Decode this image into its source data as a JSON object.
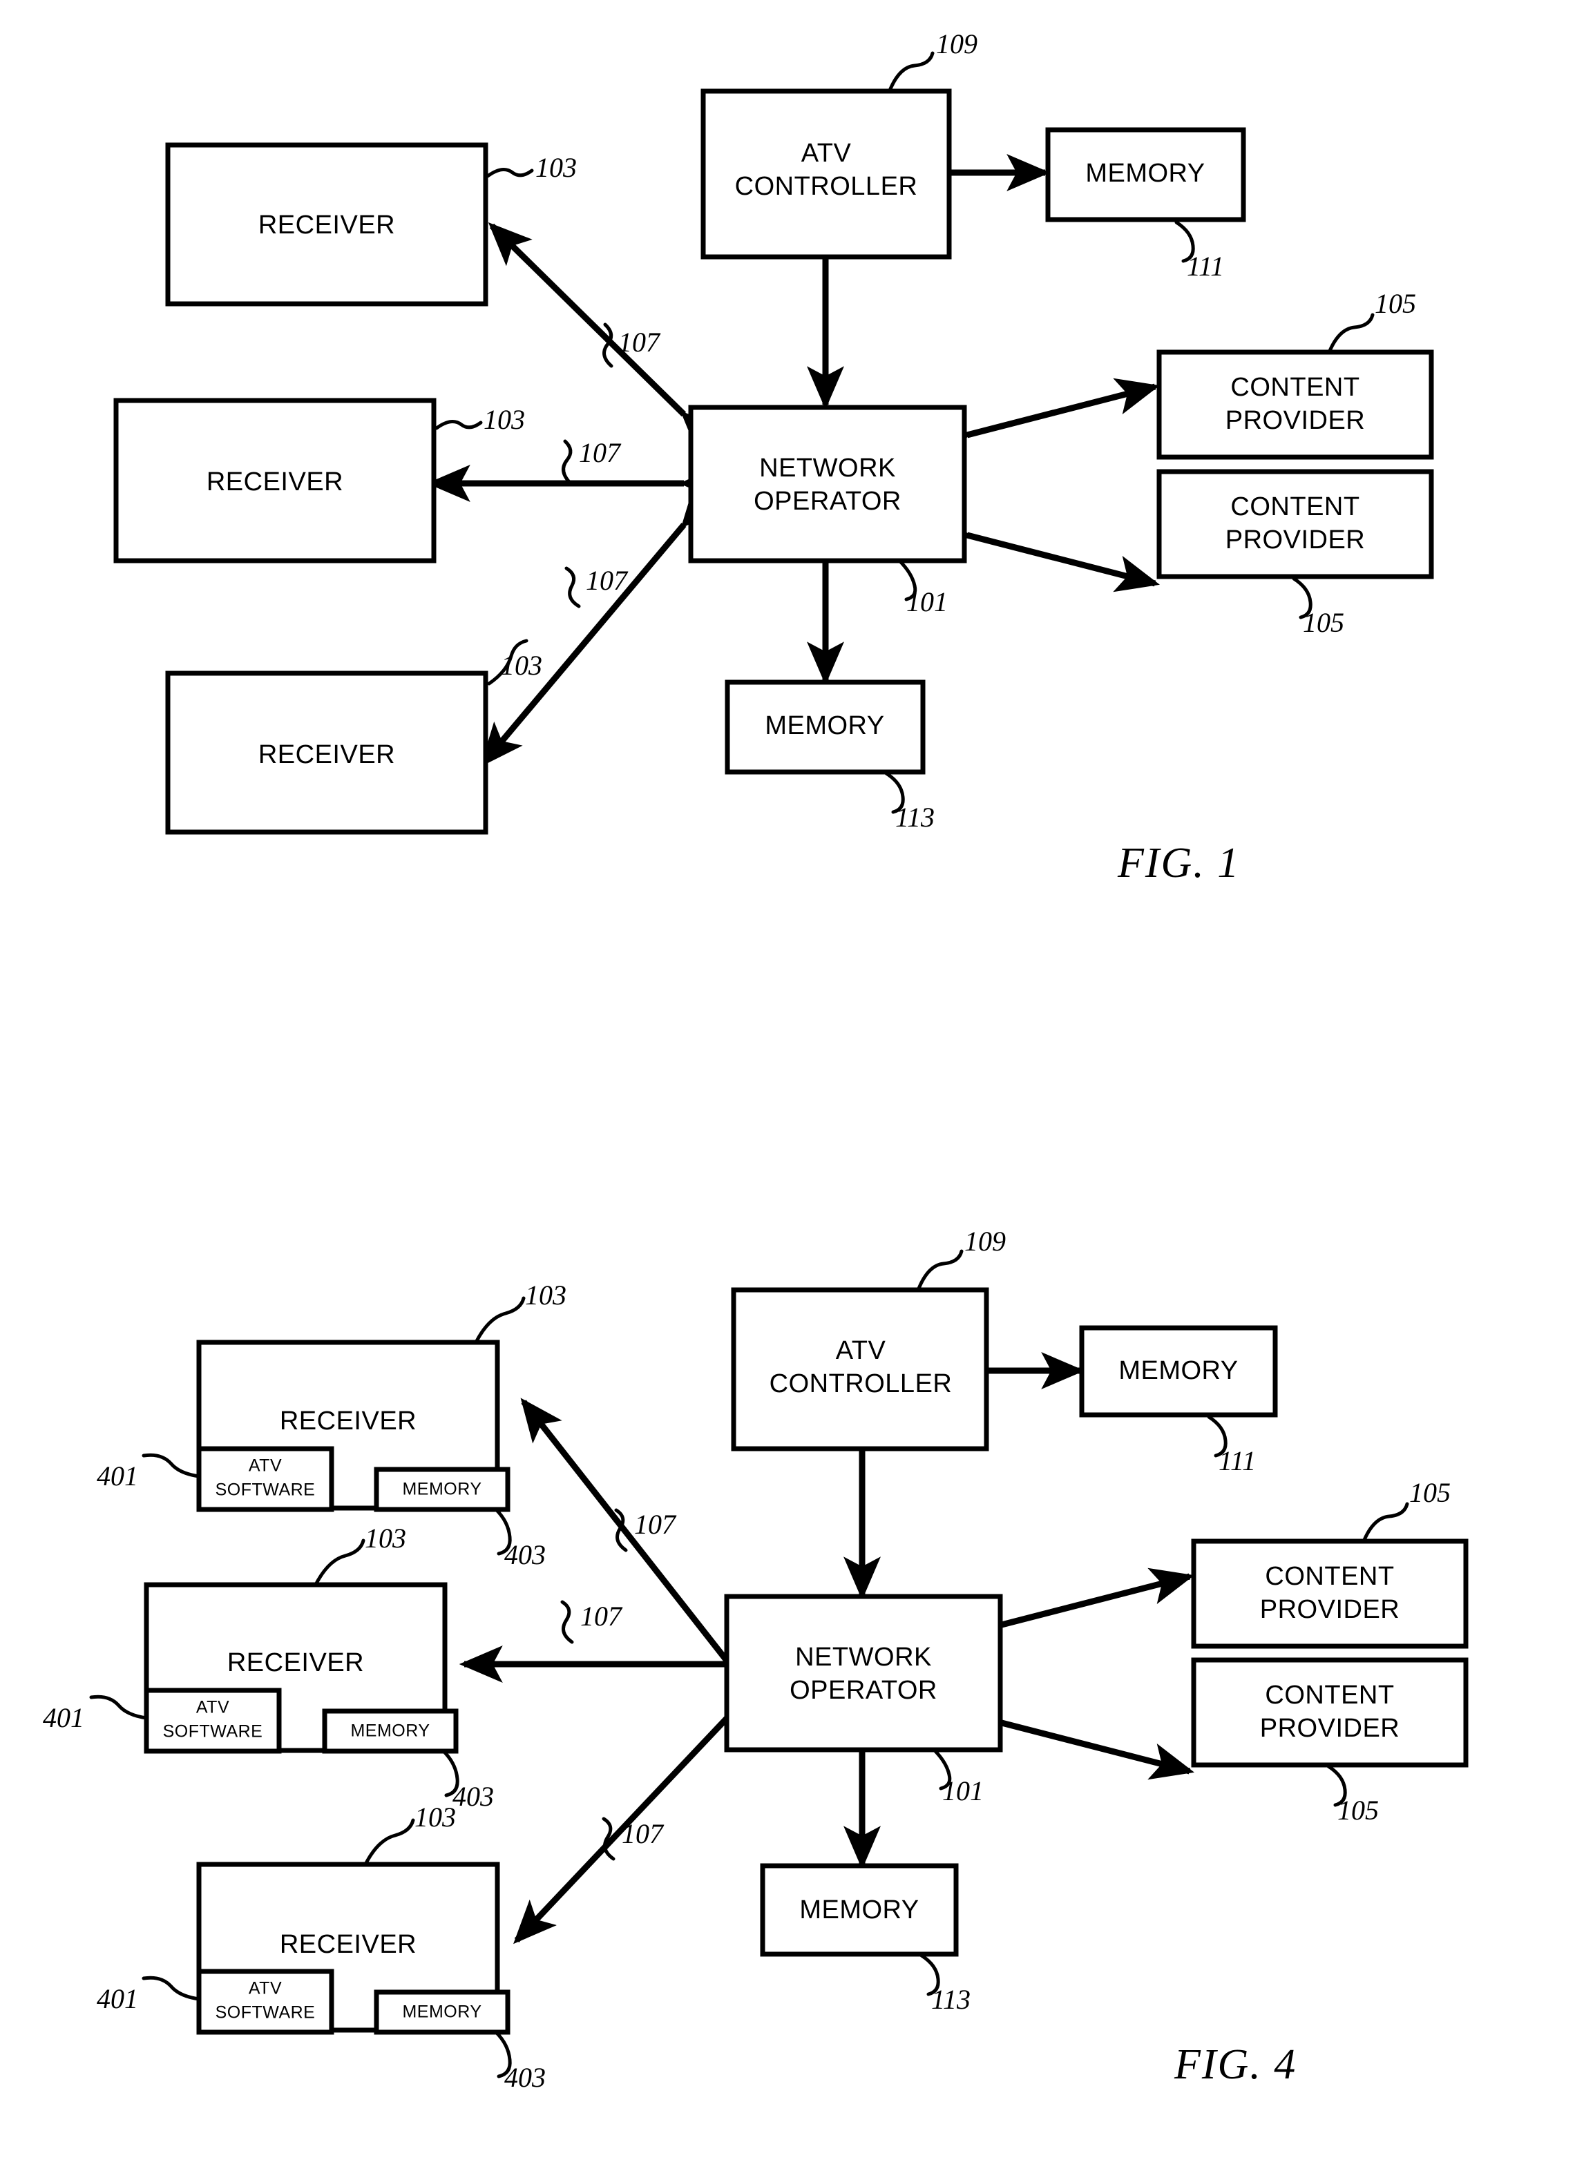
{
  "document": {
    "type": "patent-drawing-sheet",
    "figures": [
      {
        "id": "fig1",
        "caption": "FIG. 1",
        "nodes": [
          {
            "id": "receiver-1",
            "label": "RECEIVER",
            "ref": "103"
          },
          {
            "id": "receiver-2",
            "label": "RECEIVER",
            "ref": "103"
          },
          {
            "id": "receiver-3",
            "label": "RECEIVER",
            "ref": "103"
          },
          {
            "id": "atv-controller",
            "label_line1": "ATV",
            "label_line2": "CONTROLLER",
            "ref": "109"
          },
          {
            "id": "atv-memory",
            "label": "MEMORY",
            "ref": "111"
          },
          {
            "id": "network-operator",
            "label_line1": "NETWORK",
            "label_line2": "OPERATOR",
            "ref": "101"
          },
          {
            "id": "network-memory",
            "label": "MEMORY",
            "ref": "113"
          },
          {
            "id": "content-provider-1",
            "label_line1": "CONTENT",
            "label_line2": "PROVIDER",
            "ref": "105"
          },
          {
            "id": "content-provider-2",
            "label_line1": "CONTENT",
            "label_line2": "PROVIDER",
            "ref": "105"
          }
        ],
        "links": [
          {
            "from": "receiver-1",
            "to": "network-operator",
            "ref": "107",
            "style": "bidirectional"
          },
          {
            "from": "receiver-2",
            "to": "network-operator",
            "ref": "107",
            "style": "bidirectional"
          },
          {
            "from": "receiver-3",
            "to": "network-operator",
            "ref": "107",
            "style": "bidirectional"
          },
          {
            "from": "atv-controller",
            "to": "atv-memory",
            "ref": "",
            "style": "bidirectional"
          },
          {
            "from": "atv-controller",
            "to": "network-operator",
            "ref": "",
            "style": "bidirectional"
          },
          {
            "from": "network-operator",
            "to": "network-memory",
            "ref": "",
            "style": "bidirectional"
          },
          {
            "from": "network-operator",
            "to": "content-provider-1",
            "ref": "",
            "style": "bidirectional"
          },
          {
            "from": "network-operator",
            "to": "content-provider-2",
            "ref": "",
            "style": "bidirectional"
          }
        ]
      },
      {
        "id": "fig4",
        "caption": "FIG. 4",
        "nodes": [
          {
            "id": "receiver-1",
            "label": "RECEIVER",
            "ref": "103",
            "children": [
              {
                "id": "atv-software",
                "label_line1": "ATV",
                "label_line2": "SOFTWARE",
                "ref": "401"
              },
              {
                "id": "rx-memory",
                "label": "MEMORY",
                "ref": "403"
              }
            ]
          },
          {
            "id": "receiver-2",
            "label": "RECEIVER",
            "ref": "103",
            "children": [
              {
                "id": "atv-software",
                "label_line1": "ATV",
                "label_line2": "SOFTWARE",
                "ref": "401"
              },
              {
                "id": "rx-memory",
                "label": "MEMORY",
                "ref": "403"
              }
            ]
          },
          {
            "id": "receiver-3",
            "label": "RECEIVER",
            "ref": "103",
            "children": [
              {
                "id": "atv-software",
                "label_line1": "ATV",
                "label_line2": "SOFTWARE",
                "ref": "401"
              },
              {
                "id": "rx-memory",
                "label": "MEMORY",
                "ref": "403"
              }
            ]
          },
          {
            "id": "atv-controller",
            "label_line1": "ATV",
            "label_line2": "CONTROLLER",
            "ref": "109"
          },
          {
            "id": "atv-memory",
            "label": "MEMORY",
            "ref": "111"
          },
          {
            "id": "network-operator",
            "label_line1": "NETWORK",
            "label_line2": "OPERATOR",
            "ref": "101"
          },
          {
            "id": "network-memory",
            "label": "MEMORY",
            "ref": "113"
          },
          {
            "id": "content-provider-1",
            "label_line1": "CONTENT",
            "label_line2": "PROVIDER",
            "ref": "105"
          },
          {
            "id": "content-provider-2",
            "label_line1": "CONTENT",
            "label_line2": "PROVIDER",
            "ref": "105"
          }
        ],
        "links": [
          {
            "from": "receiver-1",
            "to": "network-operator",
            "ref": "107",
            "style": "bidirectional"
          },
          {
            "from": "receiver-2",
            "to": "network-operator",
            "ref": "107",
            "style": "bidirectional"
          },
          {
            "from": "receiver-3",
            "to": "network-operator",
            "ref": "107",
            "style": "bidirectional"
          },
          {
            "from": "atv-controller",
            "to": "atv-memory",
            "ref": "",
            "style": "bidirectional"
          },
          {
            "from": "atv-controller",
            "to": "network-operator",
            "ref": "",
            "style": "bidirectional"
          },
          {
            "from": "network-operator",
            "to": "network-memory",
            "ref": "",
            "style": "bidirectional"
          },
          {
            "from": "network-operator",
            "to": "content-provider-1",
            "ref": "",
            "style": "bidirectional"
          },
          {
            "from": "network-operator",
            "to": "content-provider-2",
            "ref": "",
            "style": "bidirectional"
          }
        ]
      }
    ]
  },
  "fig1": {
    "caption": "FIG. 1",
    "receiver1": {
      "label": "RECEIVER",
      "ref": "103",
      "link_ref": "107"
    },
    "receiver2": {
      "label": "RECEIVER",
      "ref": "103",
      "link_ref": "107"
    },
    "receiver3": {
      "label": "RECEIVER",
      "ref": "103",
      "link_ref": "107"
    },
    "atv_controller": {
      "line1": "ATV",
      "line2": "CONTROLLER",
      "ref": "109"
    },
    "atv_memory": {
      "label": "MEMORY",
      "ref": "111"
    },
    "network_operator": {
      "line1": "NETWORK",
      "line2": "OPERATOR",
      "ref": "101"
    },
    "network_memory": {
      "label": "MEMORY",
      "ref": "113"
    },
    "content_provider1": {
      "line1": "CONTENT",
      "line2": "PROVIDER",
      "ref": "105"
    },
    "content_provider2": {
      "line1": "CONTENT",
      "line2": "PROVIDER",
      "ref": "105"
    }
  },
  "fig4": {
    "caption": "FIG. 4",
    "receiver1": {
      "label": "RECEIVER",
      "ref": "103",
      "link_ref": "107",
      "software": {
        "line1": "ATV",
        "line2": "SOFTWARE",
        "ref": "401"
      },
      "memory": {
        "label": "MEMORY",
        "ref": "403"
      }
    },
    "receiver2": {
      "label": "RECEIVER",
      "ref": "103",
      "link_ref": "107",
      "software": {
        "line1": "ATV",
        "line2": "SOFTWARE",
        "ref": "401"
      },
      "memory": {
        "label": "MEMORY",
        "ref": "403"
      }
    },
    "receiver3": {
      "label": "RECEIVER",
      "ref": "103",
      "link_ref": "107",
      "software": {
        "line1": "ATV",
        "line2": "SOFTWARE",
        "ref": "401"
      },
      "memory": {
        "label": "MEMORY",
        "ref": "403"
      }
    },
    "atv_controller": {
      "line1": "ATV",
      "line2": "CONTROLLER",
      "ref": "109"
    },
    "atv_memory": {
      "label": "MEMORY",
      "ref": "111"
    },
    "network_operator": {
      "line1": "NETWORK",
      "line2": "OPERATOR",
      "ref": "101"
    },
    "network_memory": {
      "label": "MEMORY",
      "ref": "113"
    },
    "content_provider1": {
      "line1": "CONTENT",
      "line2": "PROVIDER",
      "ref": "105"
    },
    "content_provider2": {
      "line1": "CONTENT",
      "line2": "PROVIDER",
      "ref": "105"
    }
  },
  "colors": {
    "ink": "#000000",
    "paper": "#ffffff"
  }
}
